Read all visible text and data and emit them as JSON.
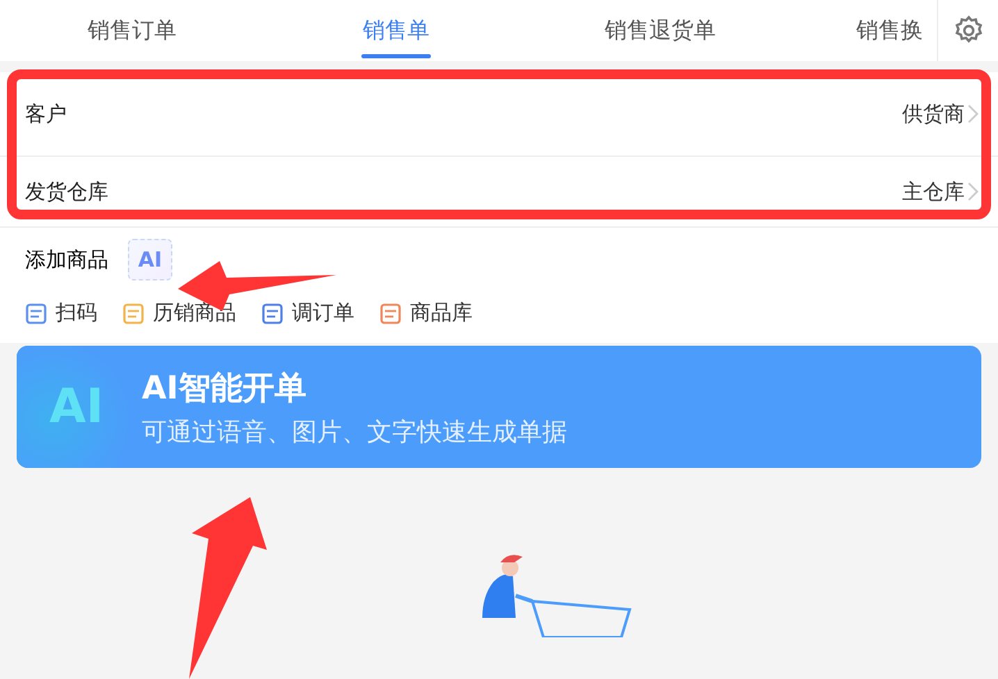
{
  "tabs": [
    {
      "label": "销售订单",
      "selected": false
    },
    {
      "label": "销售单",
      "selected": true
    },
    {
      "label": "销售退货单",
      "selected": false
    },
    {
      "label": "销售换",
      "selected": false
    }
  ],
  "form_rows": [
    {
      "label": "客户",
      "value": "供货商"
    },
    {
      "label": "发货仓库",
      "value": "主仓库"
    }
  ],
  "add_goods": {
    "title": "添加商品",
    "ai_badge": "AI"
  },
  "quick_actions": [
    {
      "label": "扫码",
      "color": "#5b8ff0"
    },
    {
      "label": "历销商品",
      "color": "#f2b34a"
    },
    {
      "label": "调订单",
      "color": "#4f7fe8"
    },
    {
      "label": "商品库",
      "color": "#f0875a"
    }
  ],
  "banner": {
    "logo_text": "AI",
    "title": "AI智能开单",
    "subtitle": "可通过语音、图片、文字快速生成单据"
  }
}
